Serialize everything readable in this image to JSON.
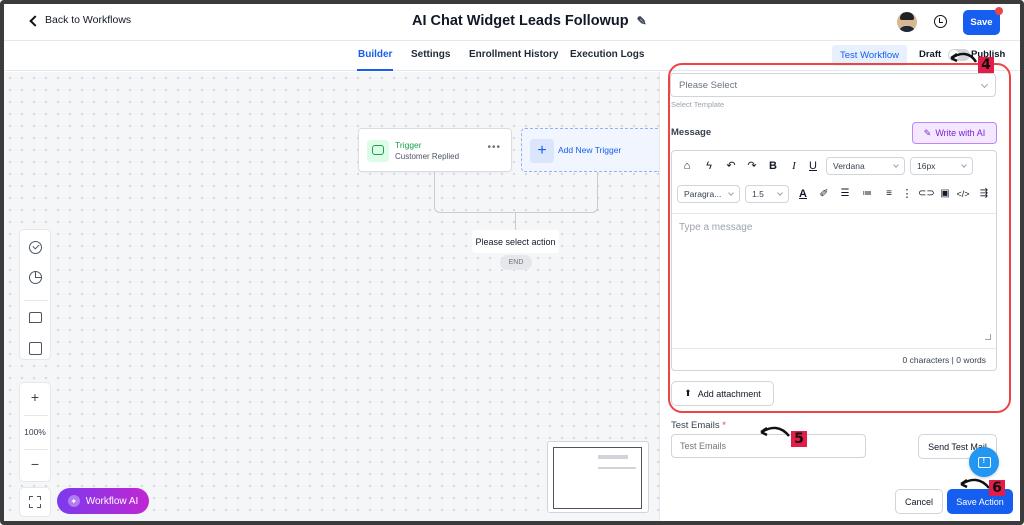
{
  "header": {
    "back_label": "Back to Workflows",
    "workflow_title": "AI Chat Widget Leads Followup",
    "save_label": "Save"
  },
  "tabs": [
    {
      "label": "Builder",
      "active": true
    },
    {
      "label": "Settings"
    },
    {
      "label": "Enrollment History"
    },
    {
      "label": "Execution Logs"
    }
  ],
  "tabbar_right": {
    "test_workflow": "Test Workflow",
    "draft": "Draft",
    "publish": "Publish"
  },
  "canvas": {
    "trigger_title": "Trigger",
    "trigger_subtitle": "Customer Replied",
    "add_trigger": "Add New Trigger",
    "select_action": "Please select action",
    "end_label": "END",
    "zoom_in": "+",
    "zoom_level": "100%",
    "zoom_out": "−",
    "workflow_ai": "Workflow AI"
  },
  "panel": {
    "template_placeholder": "Please Select",
    "template_hint": "Select Template",
    "message_label": "Message",
    "write_ai": "Write with AI",
    "font_family": "Verdana",
    "font_size": "16px",
    "paragraph": "Paragra...",
    "line_height": "1.5",
    "editor_placeholder": "Type a message",
    "counts": "0 characters | 0 words",
    "add_attachment": "Add attachment",
    "test_emails_label": "Test Emails",
    "test_emails_required": "*",
    "test_emails_placeholder": "Test Emails",
    "send_test": "Send Test Mail",
    "cancel": "Cancel",
    "save_action": "Save Action"
  },
  "annotations": {
    "m4": "4",
    "m5": "5",
    "m6": "6"
  },
  "colors": {
    "primary": "#155eef",
    "annotation_red": "#ef4444",
    "ai_gradient_start": "#7c3aed",
    "ai_gradient_end": "#c026d3",
    "trigger_green": "#16a34a"
  },
  "icons": [
    "chevron-left-icon",
    "pencil-icon",
    "history-icon",
    "tag-icon",
    "lightning-icon",
    "undo-icon",
    "redo-icon",
    "bold-icon",
    "italic-icon",
    "underline-icon",
    "text-color-icon",
    "highlight-icon",
    "bullet-list-icon",
    "numbered-list-icon",
    "align-icon",
    "more-vertical-icon",
    "link-icon",
    "image-icon",
    "code-icon",
    "clear-format-icon",
    "upload-icon",
    "chat-support-icon"
  ]
}
